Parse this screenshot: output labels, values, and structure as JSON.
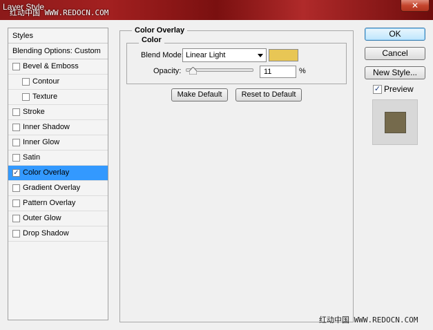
{
  "window": {
    "title": "Layer Style",
    "watermark": "红动中国 WWW.REDOCN.COM",
    "close_glyph": "✕"
  },
  "styles_list": {
    "header": "Styles",
    "blending": "Blending Options: Custom",
    "items": [
      {
        "label": "Bevel & Emboss",
        "checked": false,
        "indent": false
      },
      {
        "label": "Contour",
        "checked": false,
        "indent": true
      },
      {
        "label": "Texture",
        "checked": false,
        "indent": true
      },
      {
        "label": "Stroke",
        "checked": false,
        "indent": false
      },
      {
        "label": "Inner Shadow",
        "checked": false,
        "indent": false
      },
      {
        "label": "Inner Glow",
        "checked": false,
        "indent": false
      },
      {
        "label": "Satin",
        "checked": false,
        "indent": false
      },
      {
        "label": "Color Overlay",
        "checked": true,
        "indent": false,
        "selected": true
      },
      {
        "label": "Gradient Overlay",
        "checked": false,
        "indent": false
      },
      {
        "label": "Pattern Overlay",
        "checked": false,
        "indent": false
      },
      {
        "label": "Outer Glow",
        "checked": false,
        "indent": false
      },
      {
        "label": "Drop Shadow",
        "checked": false,
        "indent": false
      }
    ],
    "check_glyph": "✓"
  },
  "panel": {
    "title": "Color Overlay",
    "group_title": "Color",
    "blend_mode_label": "Blend Mode:",
    "blend_mode_value": "Linear Light",
    "overlay_color": "#e8c655",
    "opacity_label": "Opacity:",
    "opacity_value": "11",
    "opacity_fraction": 0.11,
    "percent": "%",
    "make_default": "Make Default",
    "reset_default": "Reset to Default"
  },
  "actions": {
    "ok": "OK",
    "cancel": "Cancel",
    "new_style": "New Style...",
    "preview_label": "Preview",
    "preview_checked": true,
    "preview_color": "#756a4c"
  }
}
